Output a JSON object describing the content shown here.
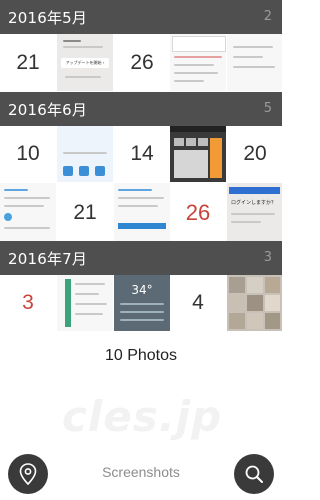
{
  "sections": [
    {
      "title": "2016年5月",
      "count": "2"
    },
    {
      "title": "2016年6月",
      "count": "5"
    },
    {
      "title": "2016年7月",
      "count": "3"
    }
  ],
  "dates": {
    "may": [
      "21",
      "26"
    ],
    "june": [
      "10",
      "14",
      "20",
      "21",
      "26"
    ],
    "july": [
      "3",
      "4"
    ]
  },
  "thumb_text": {
    "update_button": "アップデートを開始 ›",
    "dialog_title": "ログインしますか？",
    "weather_temp": "34°"
  },
  "footer": {
    "photos_count": "10 Photos",
    "watermark": "cles.jp",
    "title": "Screenshots"
  },
  "icons": {
    "left_fab": "location-pin-icon",
    "right_fab": "search-icon"
  },
  "colors": {
    "header_bg": "#4f4f4f",
    "red_date": "#c8443b",
    "fab_bg": "#3a3a3a"
  }
}
